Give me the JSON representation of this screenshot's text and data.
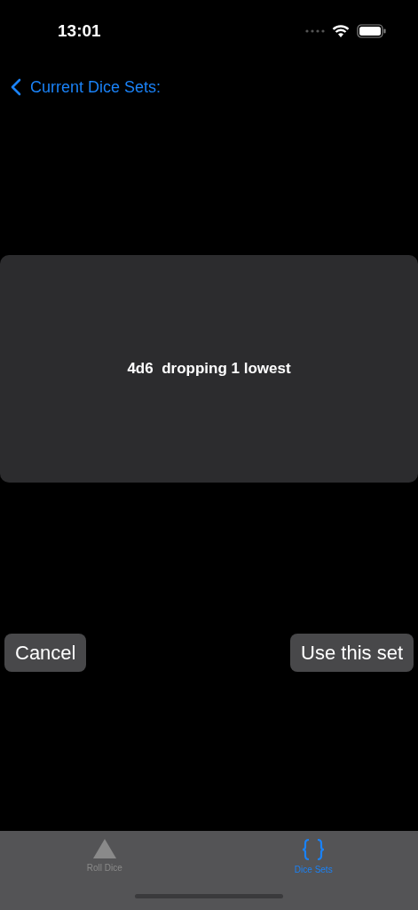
{
  "status_bar": {
    "time": "13:01"
  },
  "nav": {
    "back_label": "Current Dice Sets:"
  },
  "dice_set": {
    "description": "4d6  dropping 1 lowest"
  },
  "buttons": [
    {
      "label": "Cancel"
    },
    {
      "label": "Use this set"
    }
  ],
  "tab_bar": [
    {
      "label": "Roll Dice",
      "kind": "triangle",
      "selected": false
    },
    {
      "label": "Dice Sets",
      "kind": "braces",
      "selected": true
    }
  ]
}
